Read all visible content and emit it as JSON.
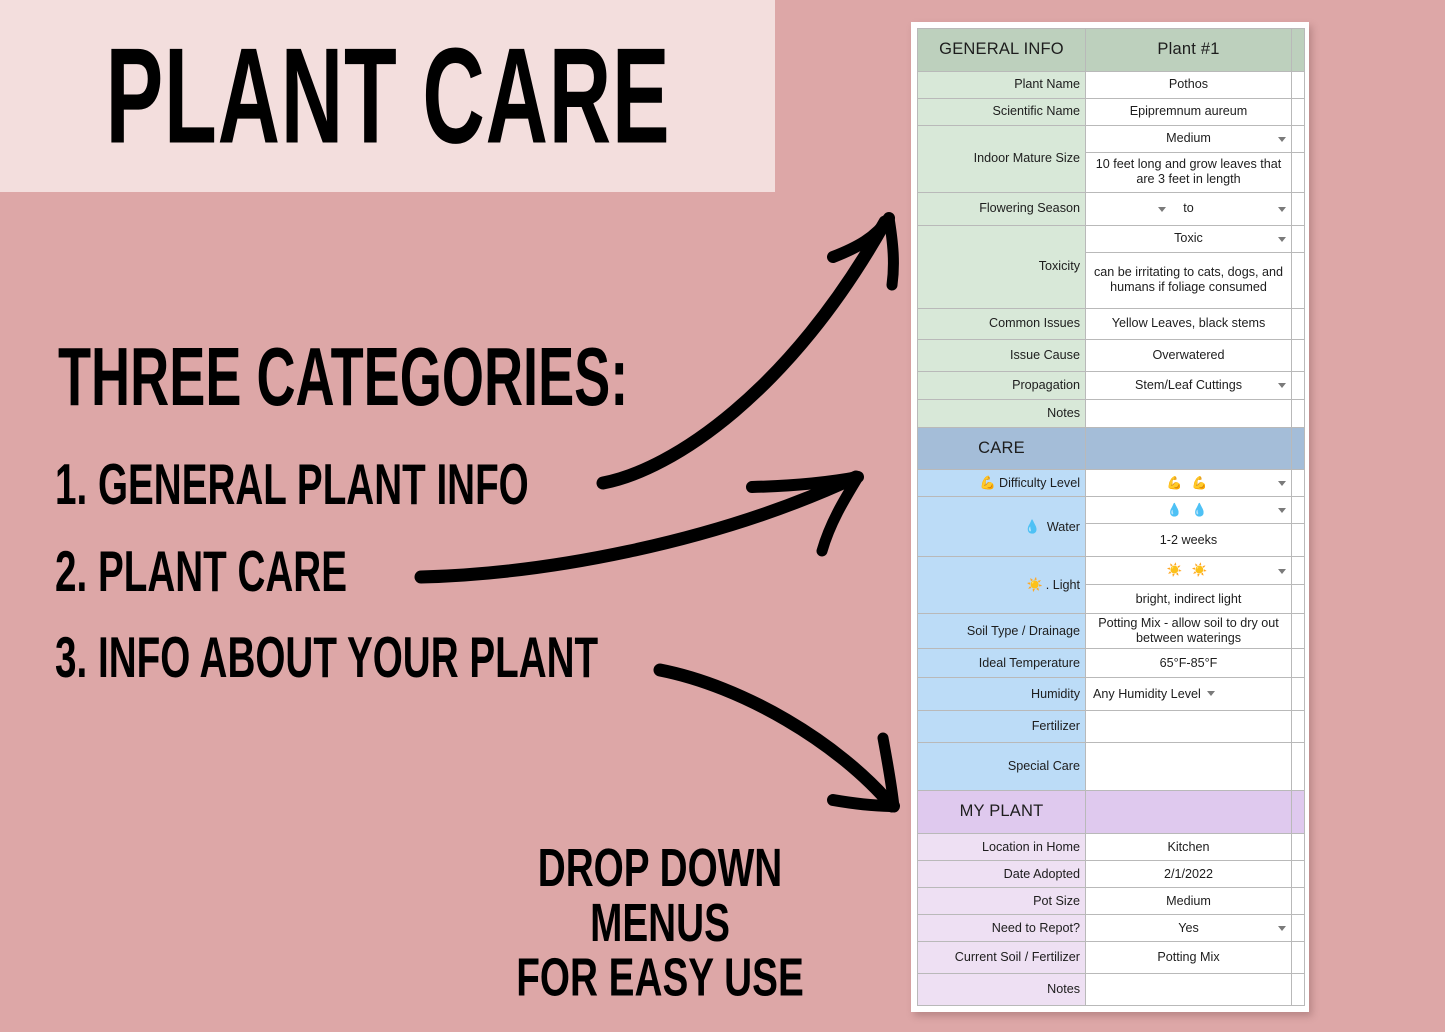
{
  "promo": {
    "title": "PLANT CARE",
    "categories_heading": "THREE CATEGORIES:",
    "categories": [
      "1.  GENERAL PLANT INFO",
      "2. PLANT CARE",
      "3. INFO ABOUT YOUR PLANT"
    ],
    "dropdown_note_line1": "DROP DOWN MENUS",
    "dropdown_note_line2": "FOR EASY USE",
    "banner_color": "#f3dedd",
    "background_color": "#dda7a7",
    "arrow_color": "#000000"
  },
  "sheet": {
    "sections": [
      {
        "key": "general",
        "header_label": "GENERAL INFO",
        "header_value": "Plant #1",
        "header_color": "#bdd0bd",
        "label_color": "#d8e8d8",
        "rows": [
          {
            "label": "Plant Name",
            "value": "Pothos",
            "dropdown": false
          },
          {
            "label": "Scientific Name",
            "value": "Epipremnum aureum",
            "dropdown": false
          },
          {
            "label": "Indoor Mature Size",
            "value": "Medium",
            "dropdown": true,
            "value2": "10 feet long and grow leaves that are 3 feet in length"
          },
          {
            "label": "Flowering Season",
            "value": "to",
            "dropdown": true,
            "dropdown_left": true
          },
          {
            "label": "Toxicity",
            "value": "Toxic",
            "dropdown": true,
            "value2": "can be irritating to cats, dogs, and humans if foliage consumed"
          },
          {
            "label": "Common Issues",
            "value": "Yellow Leaves, black stems",
            "dropdown": false
          },
          {
            "label": "Issue Cause",
            "value": "Overwatered",
            "dropdown": false
          },
          {
            "label": "Propagation",
            "value": "Stem/Leaf Cuttings",
            "dropdown": true
          },
          {
            "label": "Notes",
            "value": "",
            "dropdown": false
          }
        ]
      },
      {
        "key": "care",
        "header_label": "CARE",
        "header_value": "",
        "header_color": "#a4bdd8",
        "label_color": "#bcdcf7",
        "rows": [
          {
            "label": "Difficulty Level",
            "icon": "💪",
            "value": "💪 💪",
            "dropdown": true
          },
          {
            "label": "Water",
            "icon": "💧",
            "value": "💧 💧",
            "dropdown": true,
            "value2": "1-2 weeks"
          },
          {
            "label": "Light",
            "icon": "☀️",
            "value": "☀️ ☀️",
            "dropdown": true,
            "value2": "bright, indirect light"
          },
          {
            "label": "Soil Type / Drainage",
            "value": "Potting Mix - allow soil to dry out between waterings",
            "dropdown": false
          },
          {
            "label": "Ideal Temperature",
            "value": "65°F-85°F",
            "dropdown": false
          },
          {
            "label": "Humidity",
            "value": "Any Humidity Level",
            "dropdown": true,
            "dropdown_inline": true
          },
          {
            "label": "Fertilizer",
            "value": "",
            "dropdown": false
          },
          {
            "label": "Special Care",
            "value": "",
            "dropdown": false
          }
        ]
      },
      {
        "key": "mine",
        "header_label": "MY PLANT",
        "header_value": "",
        "header_color": "#dfc9ee",
        "label_color": "#eee0f3",
        "rows": [
          {
            "label": "Location in Home",
            "value": "Kitchen",
            "dropdown": false
          },
          {
            "label": "Date Adopted",
            "value": "2/1/2022",
            "dropdown": false
          },
          {
            "label": "Pot Size",
            "value": "Medium",
            "dropdown": false
          },
          {
            "label": "Need to Repot?",
            "value": "Yes",
            "dropdown": true
          },
          {
            "label": "Current Soil / Fertilizer",
            "value": "Potting Mix",
            "dropdown": false
          },
          {
            "label": "Notes",
            "value": "",
            "dropdown": false
          }
        ]
      }
    ]
  }
}
